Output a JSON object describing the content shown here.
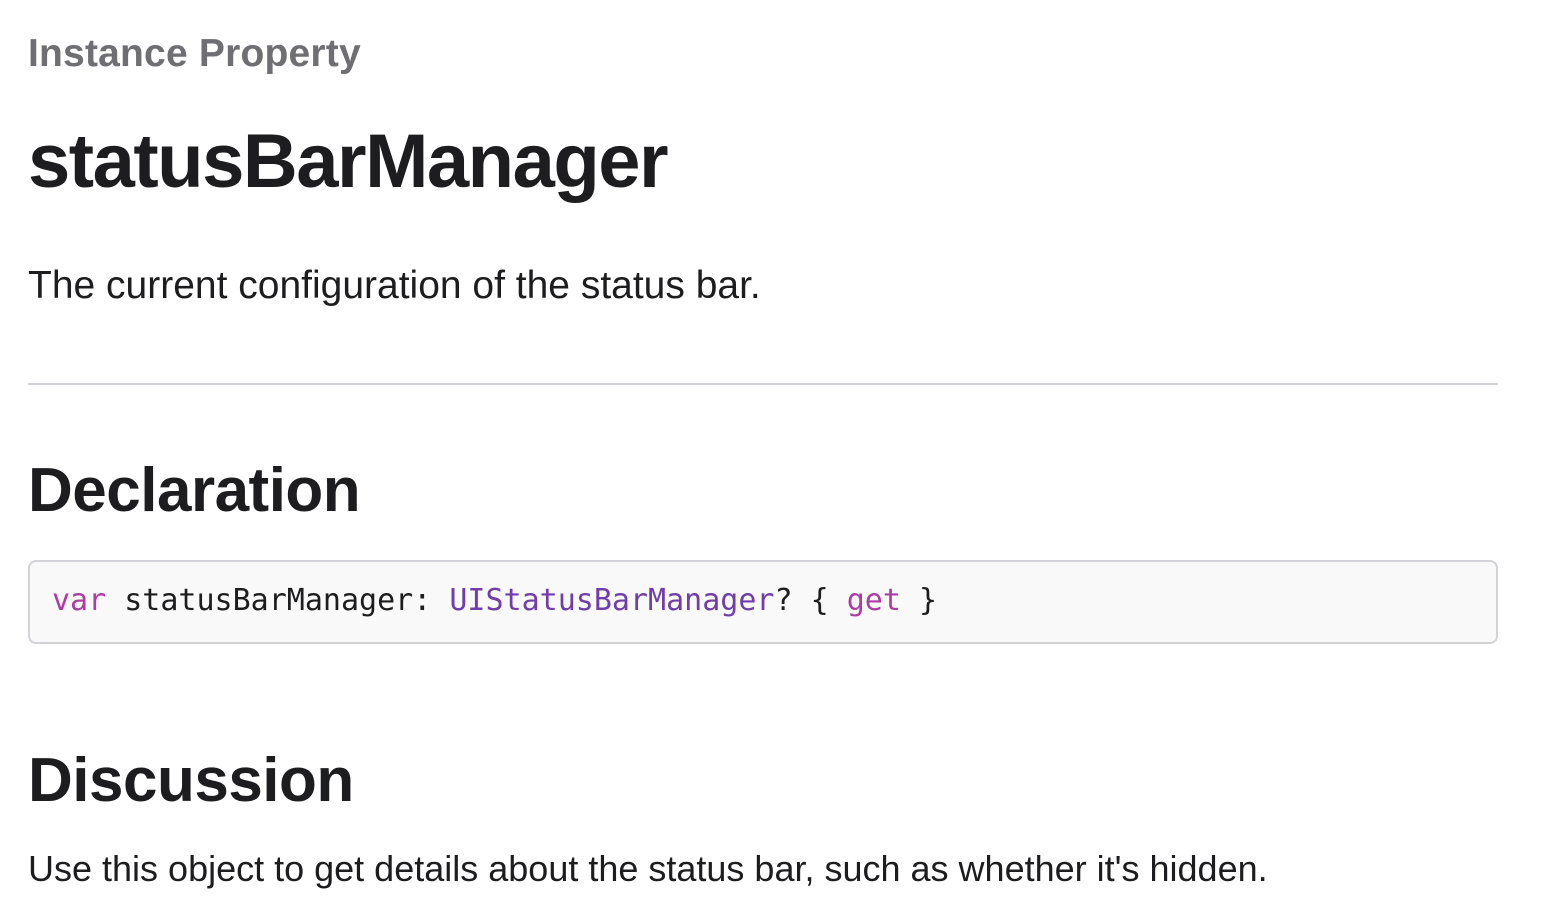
{
  "eyebrow": "Instance Property",
  "title": "statusBarManager",
  "abstract": "The current configuration of the status bar.",
  "declaration": {
    "heading": "Declaration",
    "code": {
      "keyword_var": "var",
      "name": " statusBarManager: ",
      "type": "UIStatusBarManager",
      "optional_open": "? { ",
      "keyword_get": "get",
      "close": " }"
    },
    "colors": {
      "keyword": "#ad3da4",
      "type": "#703daa",
      "background": "#f9f9f9",
      "border": "#d2d2d7"
    }
  },
  "discussion": {
    "heading": "Discussion",
    "text": "Use this object to get details about the status bar, such as whether it's hidden."
  }
}
